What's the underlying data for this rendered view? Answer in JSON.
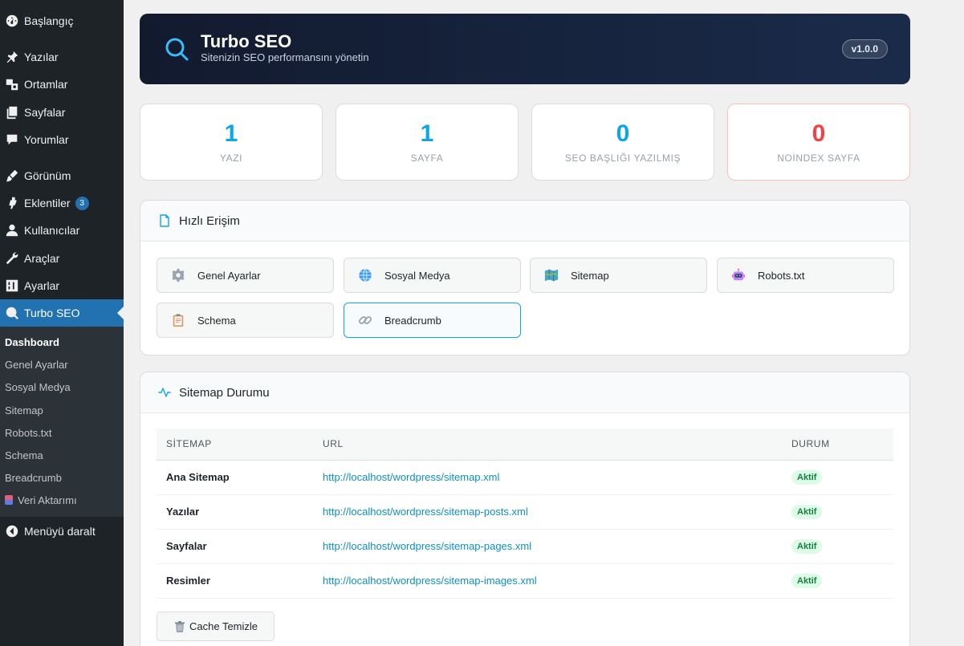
{
  "sidebar": {
    "items": [
      {
        "label": "Başlangıç",
        "icon": "dashboard-icon"
      },
      {
        "label": "Yazılar",
        "icon": "pin-icon"
      },
      {
        "label": "Ortamlar",
        "icon": "media-icon"
      },
      {
        "label": "Sayfalar",
        "icon": "pages-icon"
      },
      {
        "label": "Yorumlar",
        "icon": "comment-icon"
      },
      {
        "label": "Görünüm",
        "icon": "brush-icon"
      },
      {
        "label": "Eklentiler",
        "icon": "plugin-icon",
        "badge": "3"
      },
      {
        "label": "Kullanıcılar",
        "icon": "user-icon"
      },
      {
        "label": "Araçlar",
        "icon": "wrench-icon"
      },
      {
        "label": "Ayarlar",
        "icon": "settings-icon"
      },
      {
        "label": "Turbo SEO",
        "icon": "search-icon"
      }
    ],
    "submenu": [
      "Dashboard",
      "Genel Ayarlar",
      "Sosyal Medya",
      "Sitemap",
      "Robots.txt",
      "Schema",
      "Breadcrumb",
      "Veri Aktarımı"
    ],
    "collapse_label": "Menüyü daralt"
  },
  "header": {
    "title": "Turbo SEO",
    "subtitle": "Sitenizin SEO performansını yönetin",
    "version": "v1.0.0"
  },
  "stats": [
    {
      "value": "1",
      "label": "YAZI"
    },
    {
      "value": "1",
      "label": "SAYFA"
    },
    {
      "value": "0",
      "label": "SEO BAŞLIĞI YAZILMIŞ"
    },
    {
      "value": "0",
      "label": "NOİNDEX SAYFA"
    }
  ],
  "quick_access": {
    "title": "Hızlı Erişim",
    "buttons": [
      {
        "label": "Genel Ayarlar",
        "icon": "gear-icon"
      },
      {
        "label": "Sosyal Medya",
        "icon": "globe-icon"
      },
      {
        "label": "Sitemap",
        "icon": "map-icon"
      },
      {
        "label": "Robots.txt",
        "icon": "robot-icon"
      },
      {
        "label": "Schema",
        "icon": "clipboard-icon"
      },
      {
        "label": "Breadcrumb",
        "icon": "link-icon"
      }
    ]
  },
  "sitemap_status": {
    "title": "Sitemap Durumu",
    "columns": [
      "SİTEMAP",
      "URL",
      "DURUM"
    ],
    "rows": [
      {
        "name": "Ana Sitemap",
        "url": "http://localhost/wordpress/sitemap.xml",
        "status": "Aktif"
      },
      {
        "name": "Yazılar",
        "url": "http://localhost/wordpress/sitemap-posts.xml",
        "status": "Aktif"
      },
      {
        "name": "Sayfalar",
        "url": "http://localhost/wordpress/sitemap-pages.xml",
        "status": "Aktif"
      },
      {
        "name": "Resimler",
        "url": "http://localhost/wordpress/sitemap-images.xml",
        "status": "Aktif"
      }
    ],
    "cache_button": "Cache Temizle"
  },
  "colors": {
    "accent": "#0ea5e9",
    "danger": "#ef4444",
    "wp_blue": "#2271b1",
    "sidebar_bg": "#1d2327"
  }
}
